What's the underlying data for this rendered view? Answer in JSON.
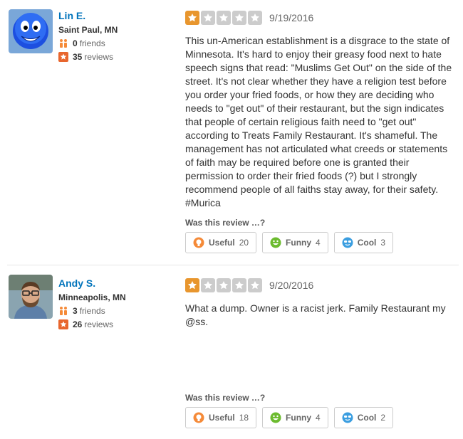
{
  "reviews": [
    {
      "user": {
        "name": "Lin E.",
        "location": "Saint Paul, MN",
        "friends_count": "0",
        "friends_label": "friends",
        "reviews_count": "35",
        "reviews_label": "reviews"
      },
      "rating": 1,
      "date": "9/19/2016",
      "text": "This un-American establishment is a disgrace to the state of Minnesota. It's hard to enjoy their greasy food next to hate speech signs that read: \"Muslims Get Out\" on the side of the street. It's not clear whether they have a religion test before you order your fried foods, or how they are deciding who needs to \"get out\" of their restaurant, but the sign indicates that people of certain religious faith need to \"get out\" according to Treats Family Restaurant. It's shameful. The management has not articulated what creeds or statements of faith may be required before one is granted their permission to order their fried foods (?) but I strongly recommend people of all faiths stay away, for their safety. #Murica",
      "vote_prompt": "Was this review …?",
      "votes": {
        "useful_label": "Useful",
        "useful": "20",
        "funny_label": "Funny",
        "funny": "4",
        "cool_label": "Cool",
        "cool": "3"
      }
    },
    {
      "user": {
        "name": "Andy S.",
        "location": "Minneapolis, MN",
        "friends_count": "3",
        "friends_label": "friends",
        "reviews_count": "26",
        "reviews_label": "reviews"
      },
      "rating": 1,
      "date": "9/20/2016",
      "text": "What a dump.  Owner is a racist jerk.  Family Restaurant my @ss.",
      "vote_prompt": "Was this review …?",
      "votes": {
        "useful_label": "Useful",
        "useful": "18",
        "funny_label": "Funny",
        "funny": "4",
        "cool_label": "Cool",
        "cool": "2"
      }
    }
  ],
  "colors": {
    "link": "#0073bb",
    "star_on": "#e8962e",
    "star_off": "#cccccc",
    "useful": "#f58a38",
    "funny": "#6cbb2f",
    "cool": "#3b9ee0"
  }
}
